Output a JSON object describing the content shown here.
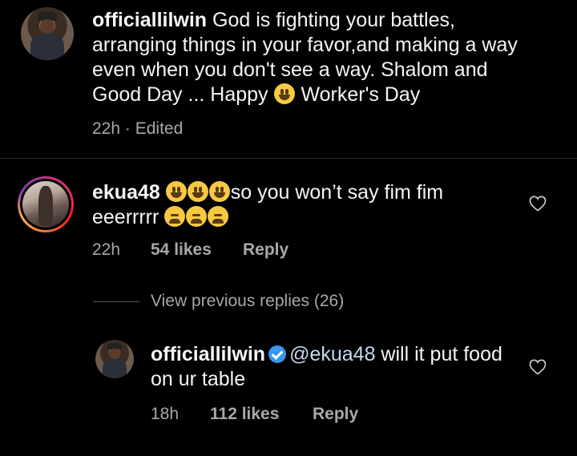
{
  "post": {
    "username": "officiallilwin",
    "caption_part1": " God is fighting your battles, arranging things in your favor,and making a way even when you don't see a way. Shalom and Good Day ... Happy ",
    "caption_part2": " Worker's Day",
    "time": "22h",
    "separator": " · ",
    "edited": "Edited"
  },
  "comment": {
    "username": "ekua48",
    "text_part1": "so you won’t say fim fim eeerrrrr",
    "time": "22h",
    "likes": "54 likes",
    "reply_label": "Reply",
    "emoji_1": "grinning-face-emoji",
    "emoji_2": "tired-face-emoji"
  },
  "view_replies": "View previous replies (26)",
  "reply": {
    "username": "officiallilwin",
    "mention": "@ekua48",
    "text": " will it put food on ur table",
    "time": "18h",
    "likes": "112 likes",
    "reply_label": "Reply"
  },
  "colors": {
    "background": "#000000",
    "text": "#f5f5f5",
    "secondary": "#a8a8a8",
    "verified": "#3897f0"
  }
}
